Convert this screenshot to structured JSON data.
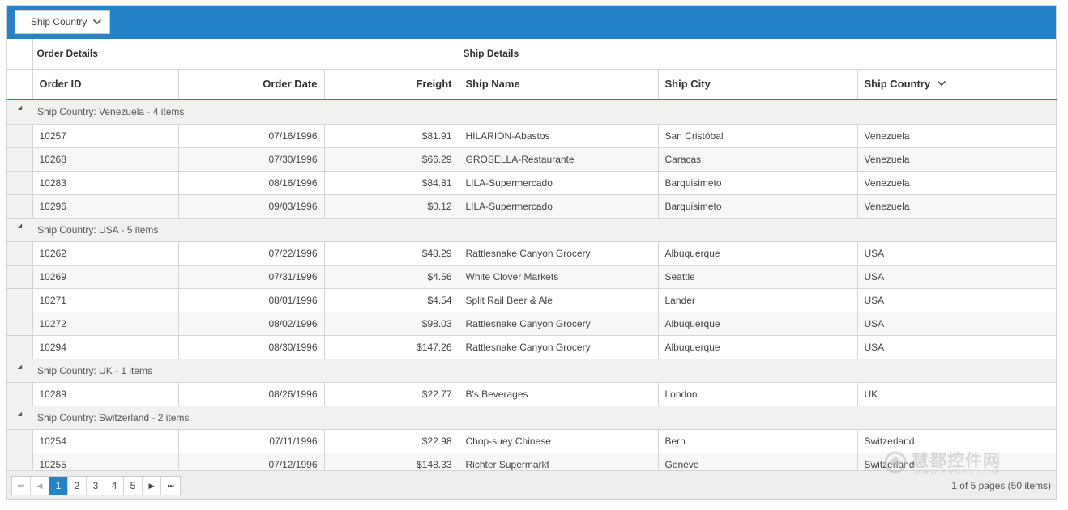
{
  "groupbar": {
    "chip_label": "Ship Country",
    "chip_icon": "chevron-down-icon"
  },
  "header_groups": {
    "order_details": "Order Details",
    "ship_details": "Ship Details"
  },
  "columns": {
    "order_id": "Order ID",
    "order_date": "Order Date",
    "freight": "Freight",
    "ship_name": "Ship Name",
    "ship_city": "Ship City",
    "ship_country": "Ship Country"
  },
  "groups": [
    {
      "label": "Ship Country: Venezuela - 4 items",
      "rows": [
        [
          "10257",
          "07/16/1996",
          "$81.91",
          "HILARION-Abastos",
          "San Cristóbal",
          "Venezuela"
        ],
        [
          "10268",
          "07/30/1996",
          "$66.29",
          "GROSELLA-Restaurante",
          "Caracas",
          "Venezuela"
        ],
        [
          "10283",
          "08/16/1996",
          "$84.81",
          "LILA-Supermercado",
          "Barquisimeto",
          "Venezuela"
        ],
        [
          "10296",
          "09/03/1996",
          "$0.12",
          "LILA-Supermercado",
          "Barquisimeto",
          "Venezuela"
        ]
      ]
    },
    {
      "label": "Ship Country: USA - 5 items",
      "rows": [
        [
          "10262",
          "07/22/1996",
          "$48.29",
          "Rattlesnake Canyon Grocery",
          "Albuquerque",
          "USA"
        ],
        [
          "10269",
          "07/31/1996",
          "$4.56",
          "White Clover Markets",
          "Seattle",
          "USA"
        ],
        [
          "10271",
          "08/01/1996",
          "$4.54",
          "Split Rail Beer & Ale",
          "Lander",
          "USA"
        ],
        [
          "10272",
          "08/02/1996",
          "$98.03",
          "Rattlesnake Canyon Grocery",
          "Albuquerque",
          "USA"
        ],
        [
          "10294",
          "08/30/1996",
          "$147.26",
          "Rattlesnake Canyon Grocery",
          "Albuquerque",
          "USA"
        ]
      ]
    },
    {
      "label": "Ship Country: UK - 1 items",
      "rows": [
        [
          "10289",
          "08/26/1996",
          "$22.77",
          "B's Beverages",
          "London",
          "UK"
        ]
      ]
    },
    {
      "label": "Ship Country: Switzerland - 2 items",
      "rows": [
        [
          "10254",
          "07/11/1996",
          "$22.98",
          "Chop-suey Chinese",
          "Bern",
          "Switzerland"
        ],
        [
          "10255",
          "07/12/1996",
          "$148.33",
          "Richter Supermarkt",
          "Genève",
          "Switzerland"
        ]
      ]
    }
  ],
  "pager": {
    "first_icon": "first-page-icon",
    "prev_icon": "prev-page-icon",
    "pages": [
      "1",
      "2",
      "3",
      "4",
      "5"
    ],
    "current_page": "1",
    "next_icon": "next-page-icon",
    "last_icon": "last-page-icon",
    "info": "1 of 5 pages (50 items)"
  },
  "watermark": {
    "text": "慧都控件网",
    "sub": "WWW.EVGET.COM"
  },
  "colors": {
    "accent": "#2482c6",
    "group_row_bg": "#f1f1f1",
    "alt_row_bg": "#f7f7f7",
    "border": "#d4d4d4"
  }
}
